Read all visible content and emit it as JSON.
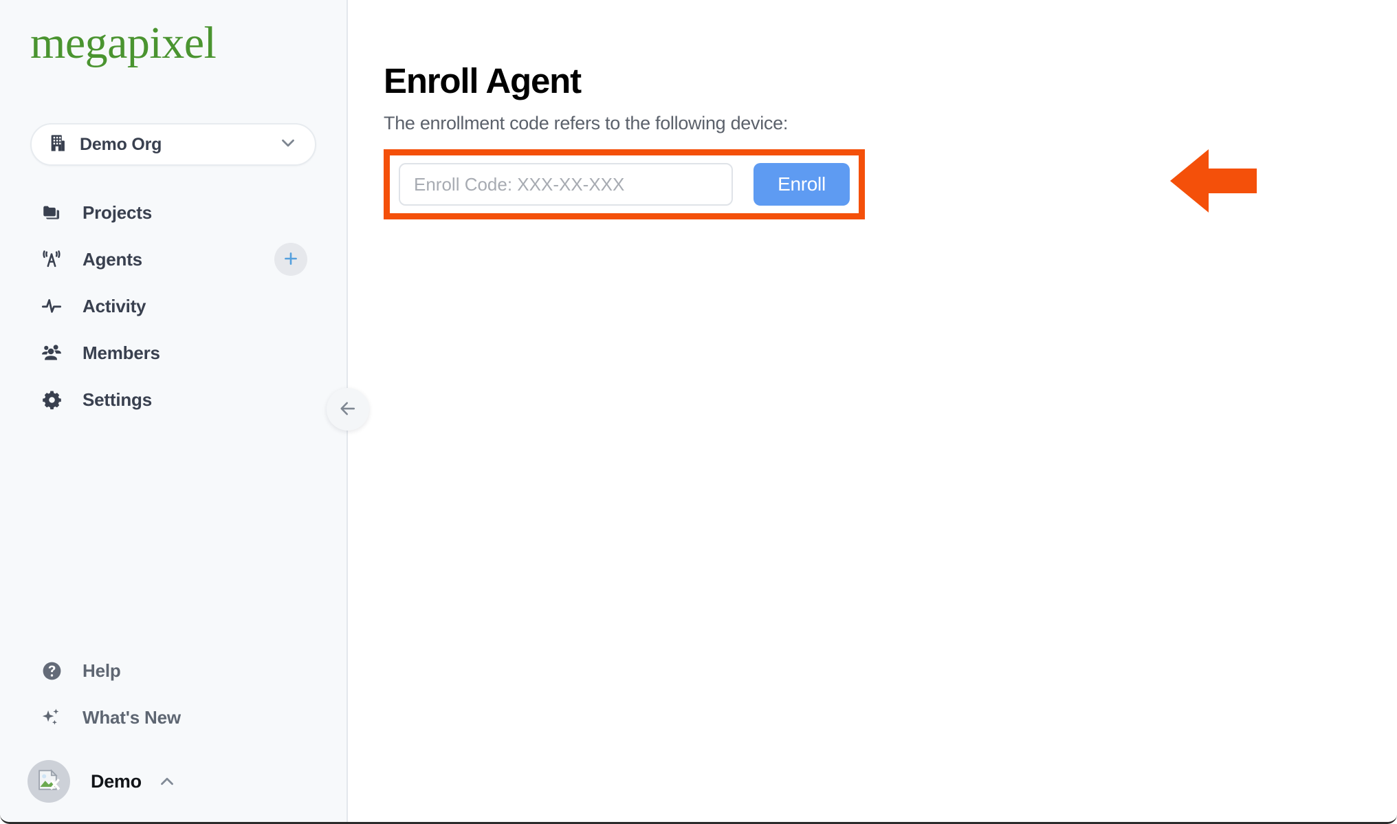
{
  "brand": {
    "logo_text": "megapixel",
    "logo_color": "#4a9430"
  },
  "sidebar": {
    "org_switcher": {
      "icon": "building-icon",
      "label": "Demo Org",
      "caret_icon": "chevron-down-icon"
    },
    "primary_items": [
      {
        "icon": "folders-icon",
        "label": "Projects"
      },
      {
        "icon": "broadcast-tower-icon",
        "label": "Agents",
        "action_icon": "plus-icon",
        "action_color": "#54a0dd"
      },
      {
        "icon": "activity-pulse-icon",
        "label": "Activity"
      },
      {
        "icon": "people-icon",
        "label": "Members"
      },
      {
        "icon": "gear-icon",
        "label": "Settings"
      }
    ],
    "secondary_items": [
      {
        "icon": "help-circle-icon",
        "label": "Help"
      },
      {
        "icon": "sparkles-icon",
        "label": "What's New"
      }
    ],
    "user": {
      "avatar_icon": "broken-image-icon",
      "name": "Demo",
      "caret_icon": "chevron-up-icon"
    },
    "collapse_button": {
      "icon": "arrow-left-icon"
    }
  },
  "main": {
    "title": "Enroll Agent",
    "subtitle": "The enrollment code refers to the following device:",
    "enroll_form": {
      "input_value": "",
      "input_placeholder": "Enroll Code: XXX-XX-XXX",
      "submit_label": "Enroll",
      "submit_color": "#5e9bf2",
      "highlight_color": "#f4500a"
    },
    "annotation": {
      "icon": "arrow-left-callout-icon",
      "color": "#f4500a"
    }
  }
}
